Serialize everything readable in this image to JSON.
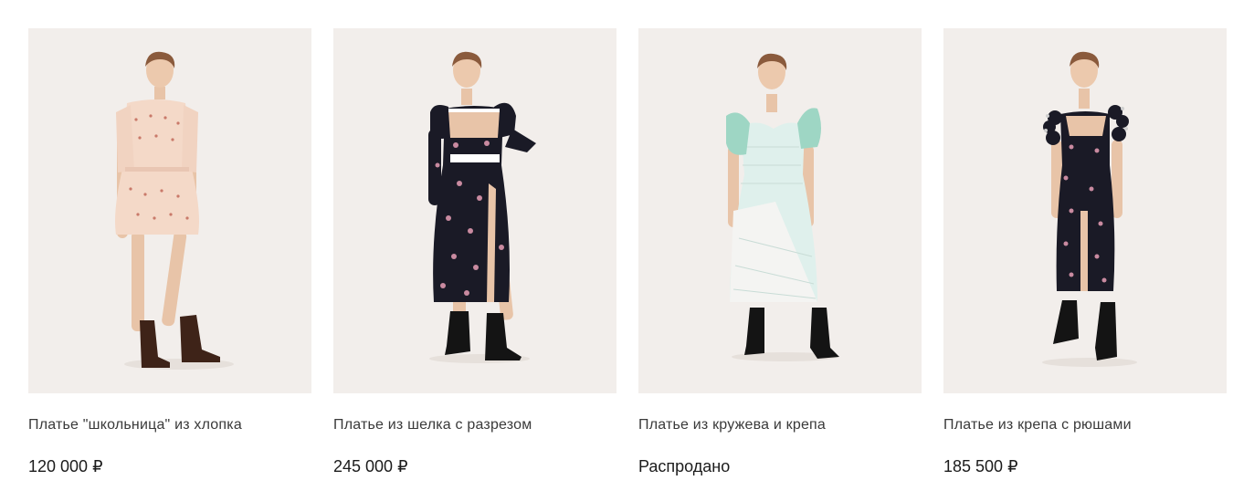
{
  "products": [
    {
      "name": "Платье \"школьница\" из хлопка",
      "price": "120 000 ₽",
      "image": "model-in-pink-floral-cotton-mini-dress-icon"
    },
    {
      "name": "Платье из шелка с разрезом",
      "price": "245 000 ₽",
      "image": "model-in-black-floral-silk-slit-dress-icon"
    },
    {
      "name": "Платье из кружева и крепа",
      "price": "Распродано",
      "image": "model-in-white-lace-mint-sleeve-dress-icon"
    },
    {
      "name": "Платье из крепа с рюшами",
      "price": "185 500 ₽",
      "image": "model-in-black-floral-ruffle-crepe-dress-icon"
    }
  ],
  "colors": {
    "photo_background": "#f2eeeb",
    "text": "#3a3a3a"
  }
}
